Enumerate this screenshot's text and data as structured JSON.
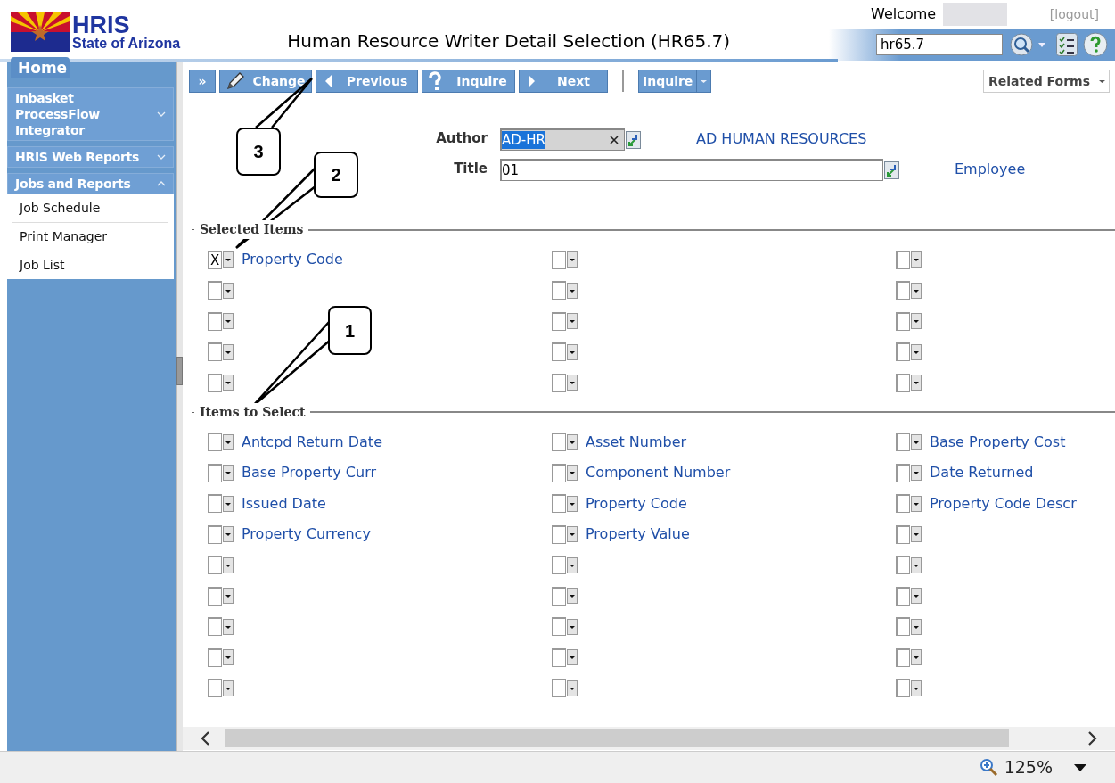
{
  "header": {
    "logo_title": "HRIS",
    "logo_subtitle": "State of Arizona",
    "page_title": "Human Resource Writer Detail Selection (HR65.7)",
    "welcome": "Welcome",
    "logout": "[logout]",
    "search_value": "hr65.7"
  },
  "sidebar": {
    "tab": "Home",
    "sections": [
      {
        "title": "Inbasket ProcessFlow Integrator",
        "expanded": false
      },
      {
        "title": "HRIS Web Reports",
        "expanded": false
      },
      {
        "title": "Jobs and Reports",
        "expanded": true,
        "items": [
          "Job Schedule",
          "Print Manager",
          "Job List"
        ]
      }
    ]
  },
  "toolbar": {
    "buttons": [
      {
        "kind": "expand",
        "label": "»"
      },
      {
        "kind": "edit",
        "label": "Change"
      },
      {
        "kind": "previous",
        "label": "Previous"
      },
      {
        "kind": "help",
        "label": "Inquire"
      },
      {
        "kind": "next",
        "label": "Next"
      }
    ],
    "menu_button": "Inquire",
    "related_forms": "Related Forms"
  },
  "form": {
    "fields": [
      {
        "label": "Author",
        "value": "AD-HR",
        "highlighted": true,
        "clearable": true,
        "description": "AD HUMAN RESOURCES"
      },
      {
        "label": "Title",
        "value": "01",
        "highlighted": false,
        "clearable": false,
        "description": "Employee"
      }
    ]
  },
  "selected_items": {
    "title": "Selected Items",
    "rows": [
      [
        {
          "value": "X",
          "label": "Property Code"
        },
        {},
        {}
      ],
      [
        {},
        {},
        {}
      ],
      [
        {},
        {},
        {}
      ],
      [
        {},
        {},
        {}
      ],
      [
        {},
        {},
        {}
      ]
    ]
  },
  "items_to_select": {
    "title": "Items to Select",
    "rows": [
      [
        {
          "label": "Antcpd Return Date"
        },
        {
          "label": "Asset Number"
        },
        {
          "label": "Base Property Cost"
        }
      ],
      [
        {
          "label": "Base Property Curr"
        },
        {
          "label": "Component Number"
        },
        {
          "label": "Date Returned"
        }
      ],
      [
        {
          "label": "Issued Date"
        },
        {
          "label": "Property Code"
        },
        {
          "label": "Property Code Descr"
        }
      ],
      [
        {
          "label": "Property Currency"
        },
        {
          "label": "Property Value"
        },
        {}
      ],
      [
        {},
        {},
        {}
      ],
      [
        {},
        {},
        {}
      ],
      [
        {},
        {},
        {}
      ],
      [
        {},
        {},
        {}
      ],
      [
        {},
        {},
        {}
      ]
    ]
  },
  "callouts": [
    {
      "number": "3"
    },
    {
      "number": "2"
    },
    {
      "number": "1"
    }
  ],
  "status_bar": {
    "zoom": "125%"
  }
}
